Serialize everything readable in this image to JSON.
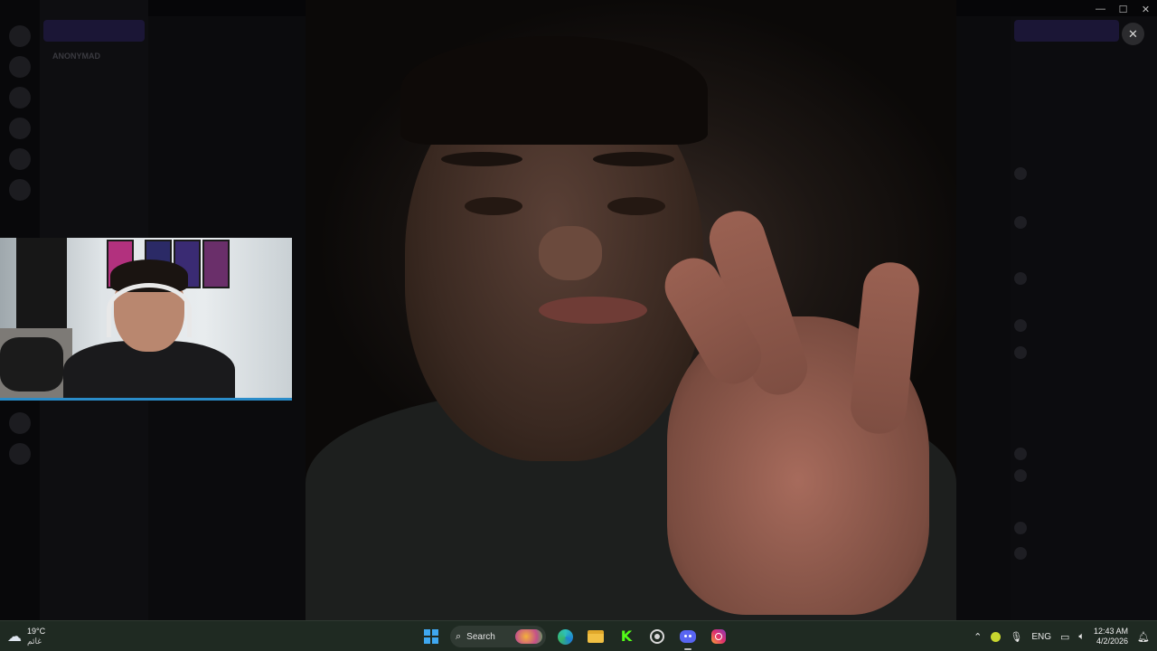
{
  "window": {
    "controls": {
      "minimize": "—",
      "maximize": "☐",
      "close": "✕"
    }
  },
  "overlay": {
    "close_glyph": "✕"
  },
  "background_app": {
    "category_label": "ANONYMAD"
  },
  "taskbar": {
    "weather": {
      "temperature": "19°C",
      "condition": "غائم",
      "icon": "cloud-icon"
    },
    "search_label": "Search",
    "apps": [
      {
        "name": "start",
        "icon": "windows-start-icon"
      },
      {
        "name": "search",
        "icon": "search-icon"
      },
      {
        "name": "edge",
        "icon": "edge-icon"
      },
      {
        "name": "file-explorer",
        "icon": "folder-icon"
      },
      {
        "name": "kick",
        "icon": "kick-icon",
        "glyph": "K"
      },
      {
        "name": "chrome",
        "icon": "chrome-icon"
      },
      {
        "name": "discord",
        "icon": "discord-icon",
        "active": true
      },
      {
        "name": "instagram",
        "icon": "instagram-icon"
      }
    ],
    "tray": {
      "chevron": "⌃",
      "language": "ENG",
      "time": "12:43 AM",
      "date": "4/2/2026"
    }
  }
}
